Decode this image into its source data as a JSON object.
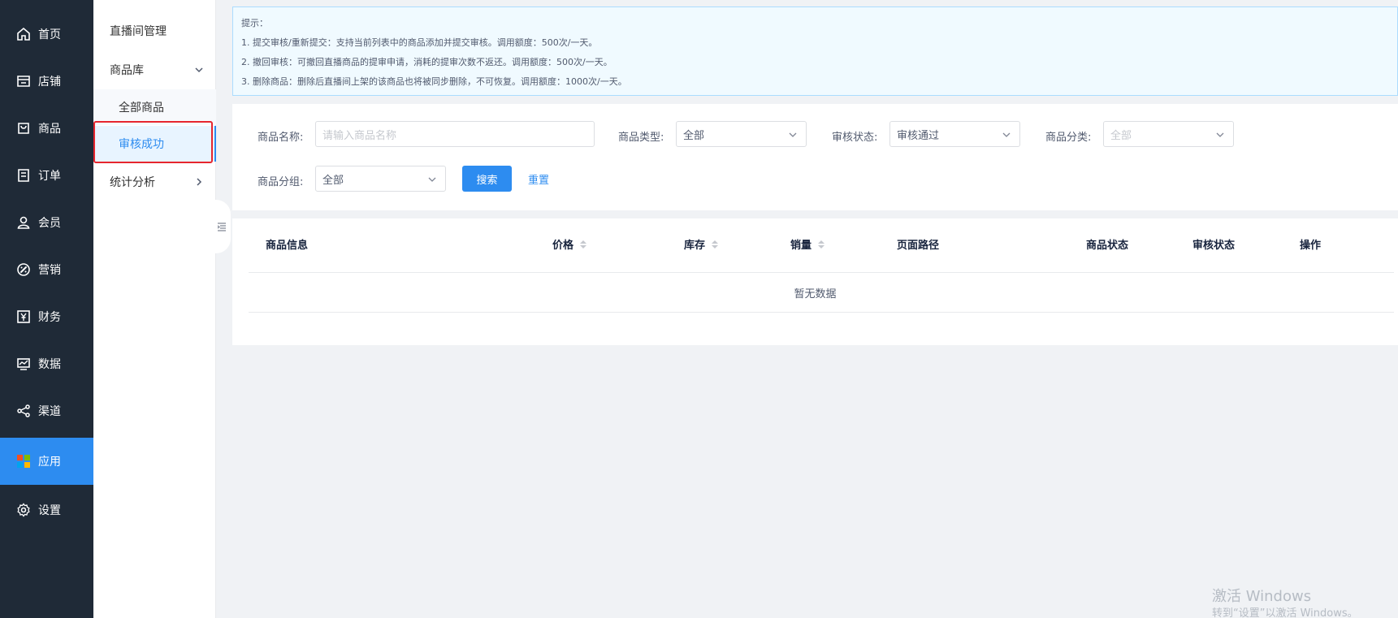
{
  "nav": {
    "items": [
      {
        "label": "首页",
        "icon": "home-icon"
      },
      {
        "label": "店铺",
        "icon": "store-icon"
      },
      {
        "label": "商品",
        "icon": "shopping-bag-icon"
      },
      {
        "label": "订单",
        "icon": "order-list-icon"
      },
      {
        "label": "会员",
        "icon": "user-icon"
      },
      {
        "label": "营销",
        "icon": "marketing-icon"
      },
      {
        "label": "财务",
        "icon": "yen-icon"
      },
      {
        "label": "数据",
        "icon": "chart-monitor-icon"
      },
      {
        "label": "渠道",
        "icon": "share-icon"
      },
      {
        "label": "应用",
        "icon": "apps-grid-icon"
      },
      {
        "label": "设置",
        "icon": "gear-icon"
      }
    ],
    "active_index": 9,
    "accent": "#2d8cf0",
    "background": "#1f2a37"
  },
  "submenu": {
    "live_room": "直播间管理",
    "product_library": "商品库",
    "all_products": "全部商品",
    "approved": "审核成功",
    "analytics": "统计分析"
  },
  "tips": {
    "title": "提示：",
    "lines": [
      "1. 提交审核/重新提交：支持当前列表中的商品添加并提交审核。调用额度：500次/一天。",
      "2. 撤回审核：可撤回直播商品的提审申请，消耗的提审次数不返还。调用额度：500次/一天。",
      "3. 删除商品：删除后直播间上架的该商品也将被同步删除，不可恢复。调用额度：1000次/一天。"
    ]
  },
  "filter": {
    "name_label": "商品名称:",
    "name_placeholder": "请输入商品名称",
    "type_label": "商品类型:",
    "type_value": "全部",
    "audit_label": "审核状态:",
    "audit_value": "审核通过",
    "category_label": "商品分类:",
    "category_value": "全部",
    "group_label": "商品分组:",
    "group_value": "全部",
    "search_button": "搜索",
    "reset_button": "重置"
  },
  "table": {
    "columns": [
      "商品信息",
      "价格",
      "库存",
      "销量",
      "页面路径",
      "商品状态",
      "审核状态",
      "操作"
    ],
    "sortable": [
      false,
      true,
      true,
      true,
      false,
      false,
      false,
      false
    ],
    "empty_text": "暂无数据"
  },
  "watermark": {
    "line1": "激活 Windows",
    "line2": "转到“设置”以激活 Windows。"
  }
}
